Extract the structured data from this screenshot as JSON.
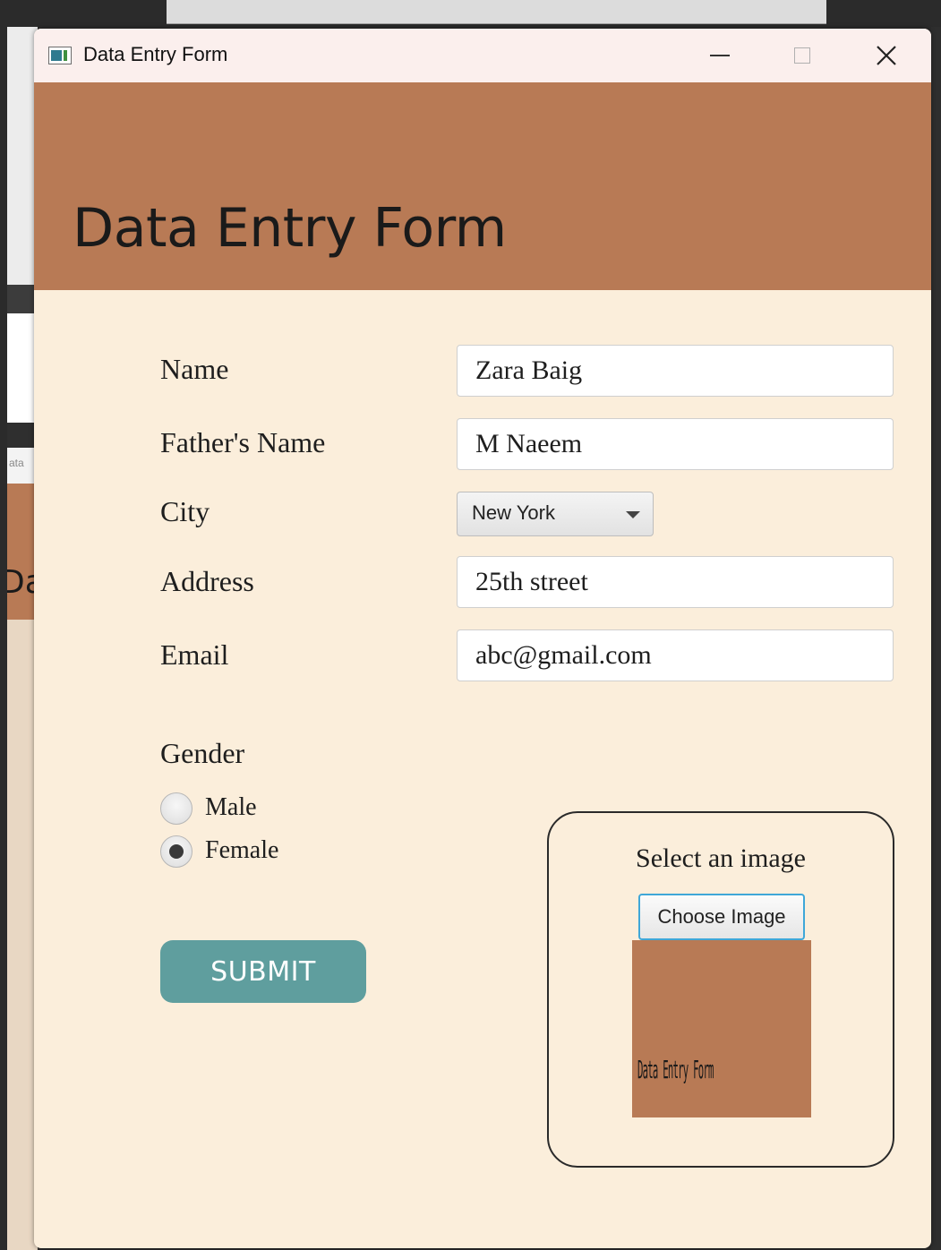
{
  "window": {
    "title": "Data Entry Form"
  },
  "header": {
    "title": "Data Entry Form",
    "background_color": "#b87a55"
  },
  "form": {
    "fields": [
      {
        "label": "Name",
        "value": "Zara Baig"
      },
      {
        "label": "Father's Name",
        "value": "M Naeem"
      },
      {
        "label": "City",
        "value": "New York"
      },
      {
        "label": "Address",
        "value": "25th street"
      },
      {
        "label": "Email",
        "value": "abc@gmail.com"
      }
    ],
    "gender": {
      "label": "Gender",
      "options": [
        {
          "label": "Male",
          "selected": false
        },
        {
          "label": "Female",
          "selected": true
        }
      ]
    },
    "submit_label": "SUBMIT",
    "submit_color": "#5f9e9e"
  },
  "image_panel": {
    "title": "Select an image",
    "button_label": "Choose Image",
    "preview_text": "Data Entry Form"
  },
  "background_fragments": {
    "left_tab_text": "ata",
    "left_heading_fragment": "Da"
  }
}
